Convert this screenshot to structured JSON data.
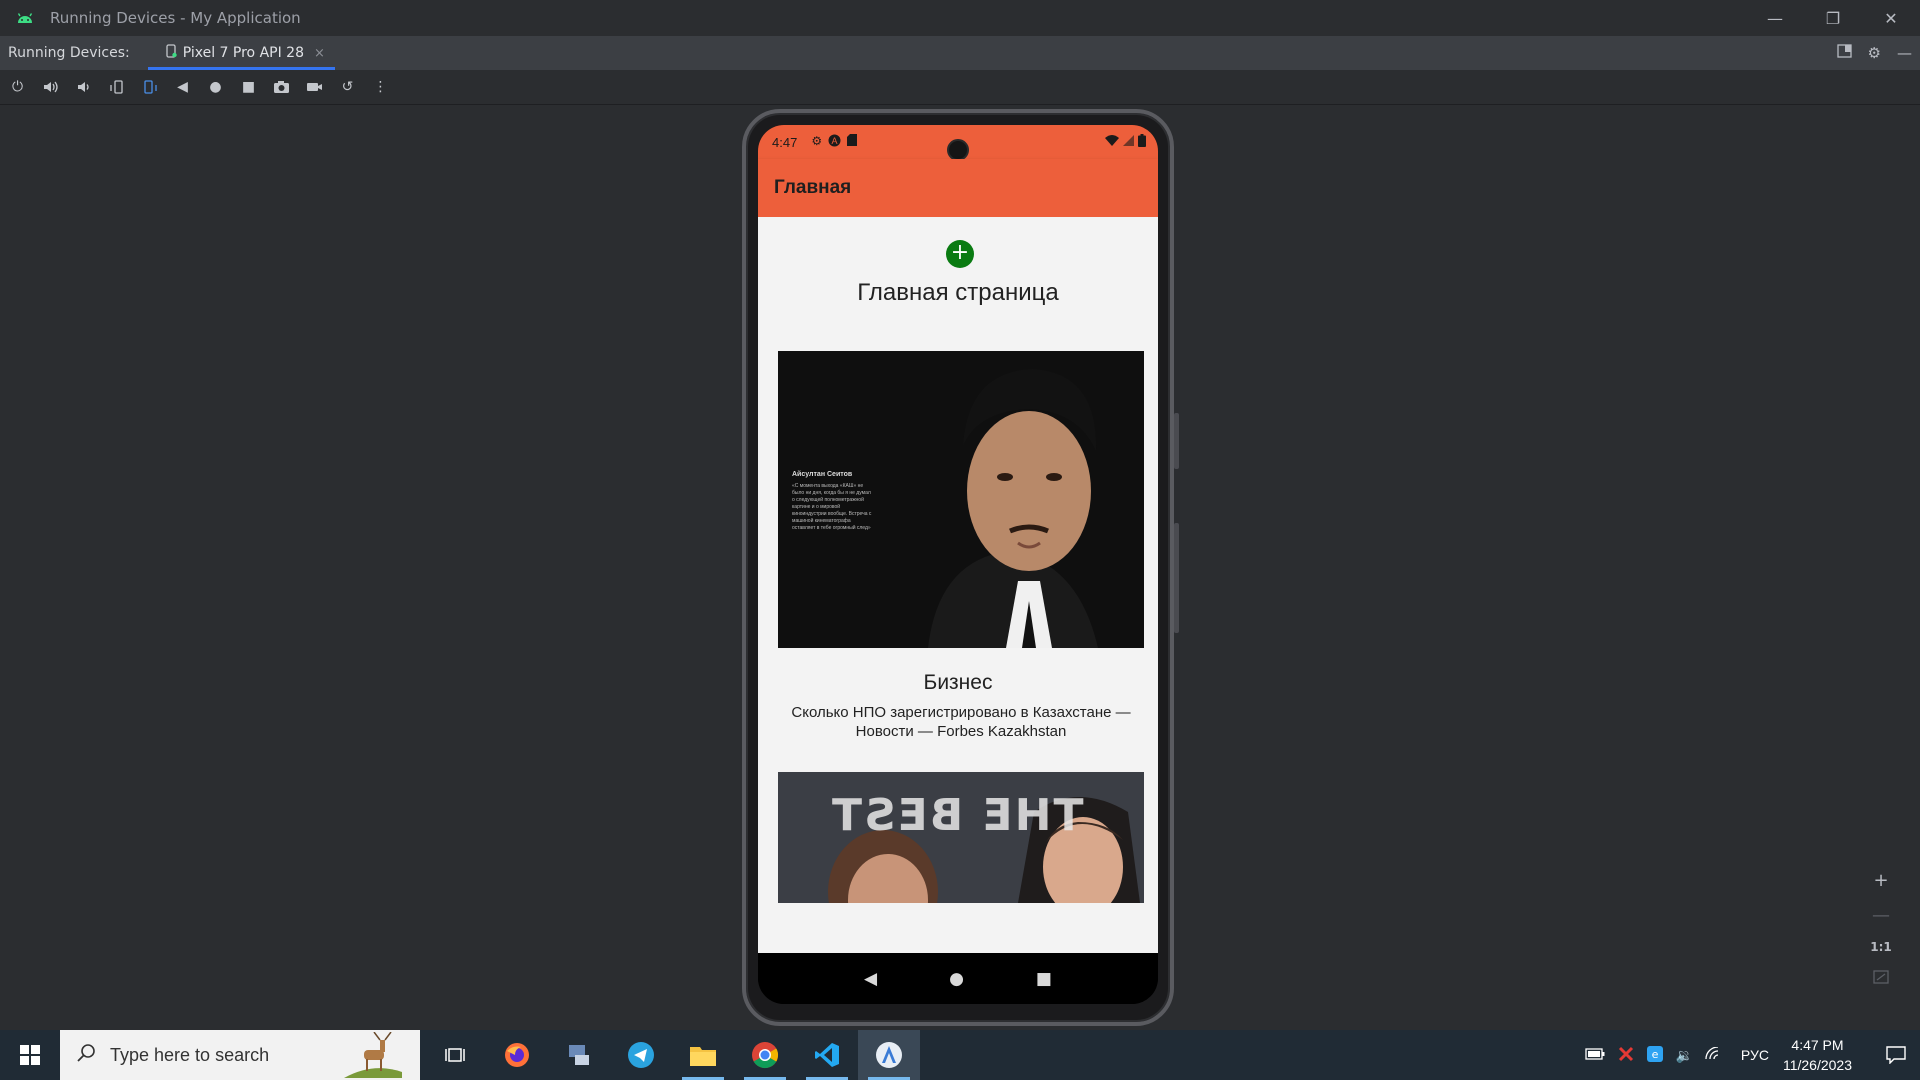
{
  "window": {
    "title": "Running Devices - My Application",
    "controls": {
      "minimize": "—",
      "restore": "❐",
      "close": "✕"
    }
  },
  "tabbar": {
    "label": "Running Devices:",
    "tab_label": "Pixel 7 Pro API 28",
    "tab_close": "×"
  },
  "device": {
    "status_time": "4:47",
    "app_bar_title": "Главная",
    "fab_symbol": "+",
    "page_heading": "Главная страница",
    "cards": [
      {
        "category": "Бизнес",
        "description": "Сколько НПО зарегистрировано в Казахстане — Новости — Forbes Kazakhstan",
        "image_caption_title": "Айсултан Сеитов",
        "image_caption_text": "«С момента выхода «КАШ» не было ни дня, когда бы я не думал о следующей полнометражной картине и о мировой киноиндустрии вообще. Встреча с машиной кинематографа оставляет в тебе огромный след»"
      },
      {
        "image_text": "THE BEST"
      }
    ],
    "accent_color": "#ed5f3b",
    "fab_color": "#0a7b12"
  },
  "zoom": {
    "zoom_in": "+",
    "zoom_out": "—",
    "actual_size": "1:1"
  },
  "taskbar": {
    "search_placeholder": "Type here to search",
    "language": "РУС",
    "time": "4:47 PM",
    "date": "11/26/2023"
  }
}
